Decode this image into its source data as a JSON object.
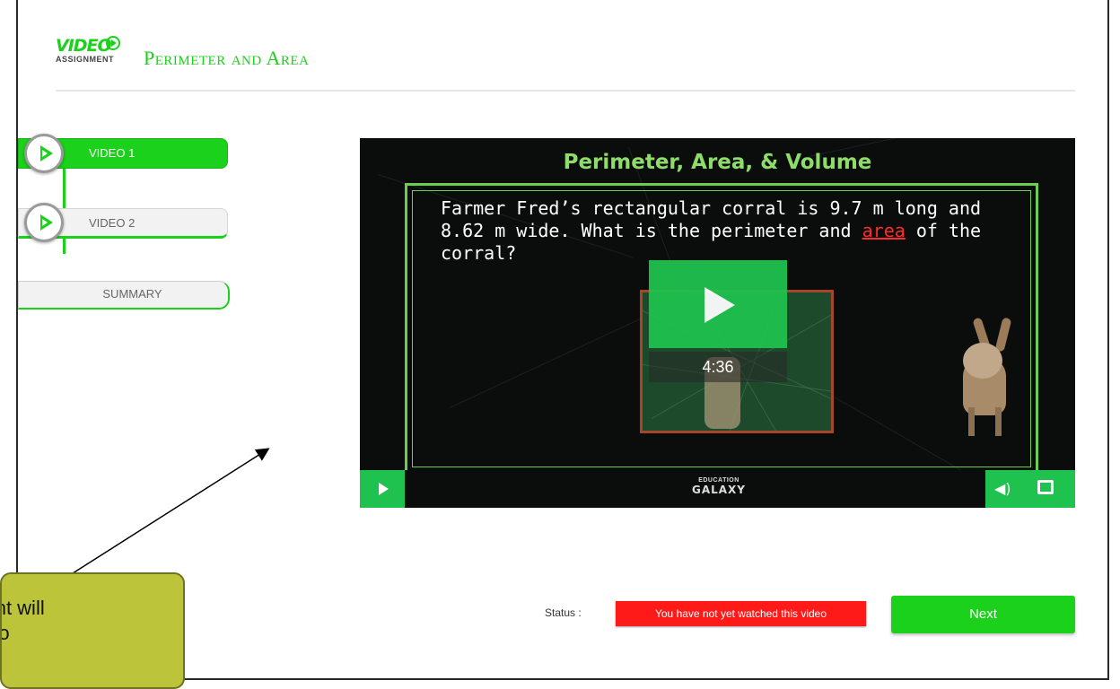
{
  "header": {
    "logo_line1": "VIDEO",
    "logo_line2": "ASSIGNMENT",
    "title": "Perimeter and Area"
  },
  "sidebar": {
    "items": [
      {
        "label": "VIDEO 1",
        "state": "active"
      },
      {
        "label": "VIDEO 2",
        "state": "inactive"
      }
    ],
    "summary_label": "SUMMARY"
  },
  "video": {
    "title": "Perimeter, Area, & Volume",
    "question_part1": "Farmer Fred’s rectangular corral is 9.7 m long and 8.62 m wide. What is the perimeter and ",
    "question_highlight": "area",
    "question_part2": " of the corral?",
    "duration": "4:36",
    "brand_line1": "EDUCATION",
    "brand_line2": "GALAXY"
  },
  "status": {
    "label": "Status :",
    "message": "You have not yet watched this video"
  },
  "next_label": "Next",
  "callout_text": "udent will\nvideo",
  "colors": {
    "accent": "#1bd11b",
    "error": "#ff1a1a",
    "callout": "#bcc43a"
  }
}
